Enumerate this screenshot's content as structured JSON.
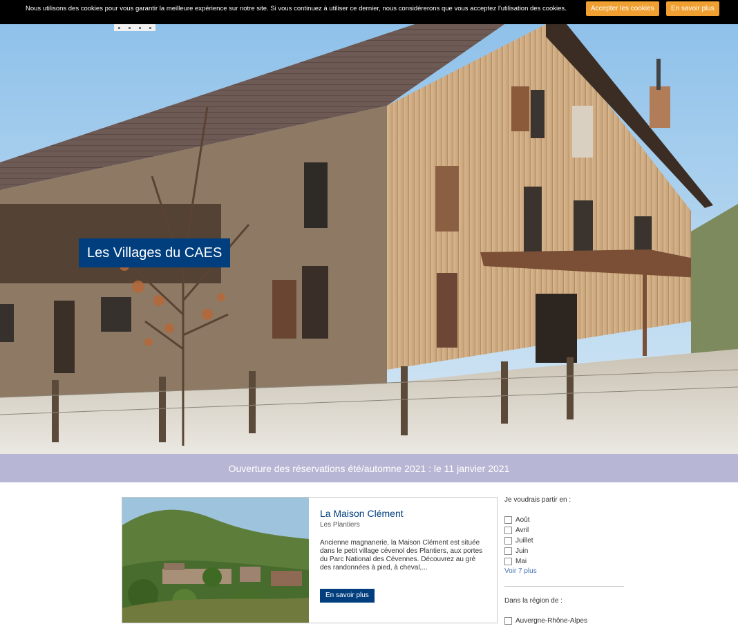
{
  "cookie": {
    "message": "Nous utilisons des cookies pour vous garantir la meilleure expérience sur notre site. Si vous continuez à utiliser ce dernier, nous considérerons que vous acceptez l'utilisation des cookies.",
    "accept_label": "Accepter les cookies",
    "more_label": "En savoir plus",
    "button_color": "#f0a030"
  },
  "hero": {
    "title": "Les Villages du CAES",
    "title_bg": "#003e7e"
  },
  "announcement": {
    "text": "Ouverture des réservations été/automne 2021 : le 11 janvier 2021",
    "bg": "#b7b6d4"
  },
  "card": {
    "title": "La Maison Clément",
    "subtitle": "Les Plantiers",
    "description": "Ancienne magnanerie, la Maison Clément est située dans le petit village cévenol des Plantiers, aux portes du Parc National des Cévennes. Découvrez au gré des randonnées à pied, à cheval,...",
    "button_label": "En savoir plus"
  },
  "filters": {
    "period_title": "Je voudrais partir en :",
    "periods": [
      "Août",
      "Avril",
      "Juillet",
      "Juin",
      "Mai"
    ],
    "period_more": "Voir 7 plus",
    "region_title": "Dans la région de :",
    "regions": [
      "Auvergne-Rhône-Alpes"
    ]
  }
}
